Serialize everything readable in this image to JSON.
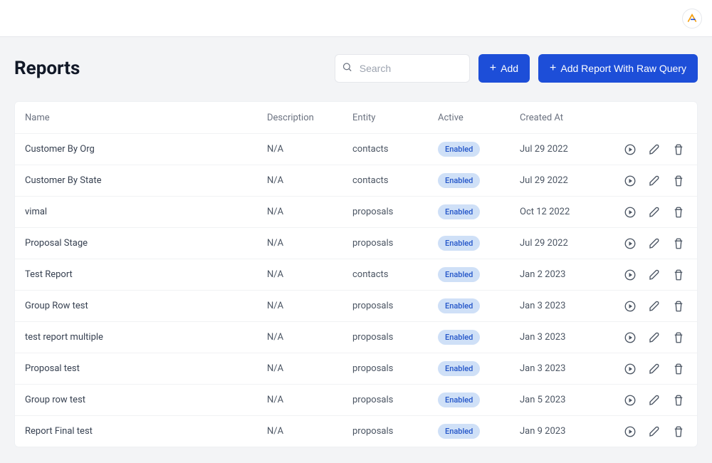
{
  "page_title": "Reports",
  "search": {
    "placeholder": "Search"
  },
  "buttons": {
    "add": "Add",
    "add_raw": "Add Report With Raw Query"
  },
  "columns": {
    "name": "Name",
    "description": "Description",
    "entity": "Entity",
    "active": "Active",
    "created_at": "Created At"
  },
  "badge_enabled": "Enabled",
  "rows": [
    {
      "name": "Customer By Org",
      "description": "N/A",
      "entity": "contacts",
      "active": "Enabled",
      "created_at": "Jul 29 2022"
    },
    {
      "name": "Customer By State",
      "description": "N/A",
      "entity": "contacts",
      "active": "Enabled",
      "created_at": "Jul 29 2022"
    },
    {
      "name": "vimal",
      "description": "N/A",
      "entity": "proposals",
      "active": "Enabled",
      "created_at": "Oct 12 2022"
    },
    {
      "name": "Proposal Stage",
      "description": "N/A",
      "entity": "proposals",
      "active": "Enabled",
      "created_at": "Jul 29 2022"
    },
    {
      "name": "Test Report",
      "description": "N/A",
      "entity": "contacts",
      "active": "Enabled",
      "created_at": "Jan 2 2023"
    },
    {
      "name": "Group Row test",
      "description": "N/A",
      "entity": "proposals",
      "active": "Enabled",
      "created_at": "Jan 3 2023"
    },
    {
      "name": "test report multiple",
      "description": "N/A",
      "entity": "proposals",
      "active": "Enabled",
      "created_at": "Jan 3 2023"
    },
    {
      "name": "Proposal test",
      "description": "N/A",
      "entity": "proposals",
      "active": "Enabled",
      "created_at": "Jan 3 2023"
    },
    {
      "name": "Group row test",
      "description": "N/A",
      "entity": "proposals",
      "active": "Enabled",
      "created_at": "Jan 5 2023"
    },
    {
      "name": "Report Final test",
      "description": "N/A",
      "entity": "proposals",
      "active": "Enabled",
      "created_at": "Jan 9 2023"
    }
  ]
}
